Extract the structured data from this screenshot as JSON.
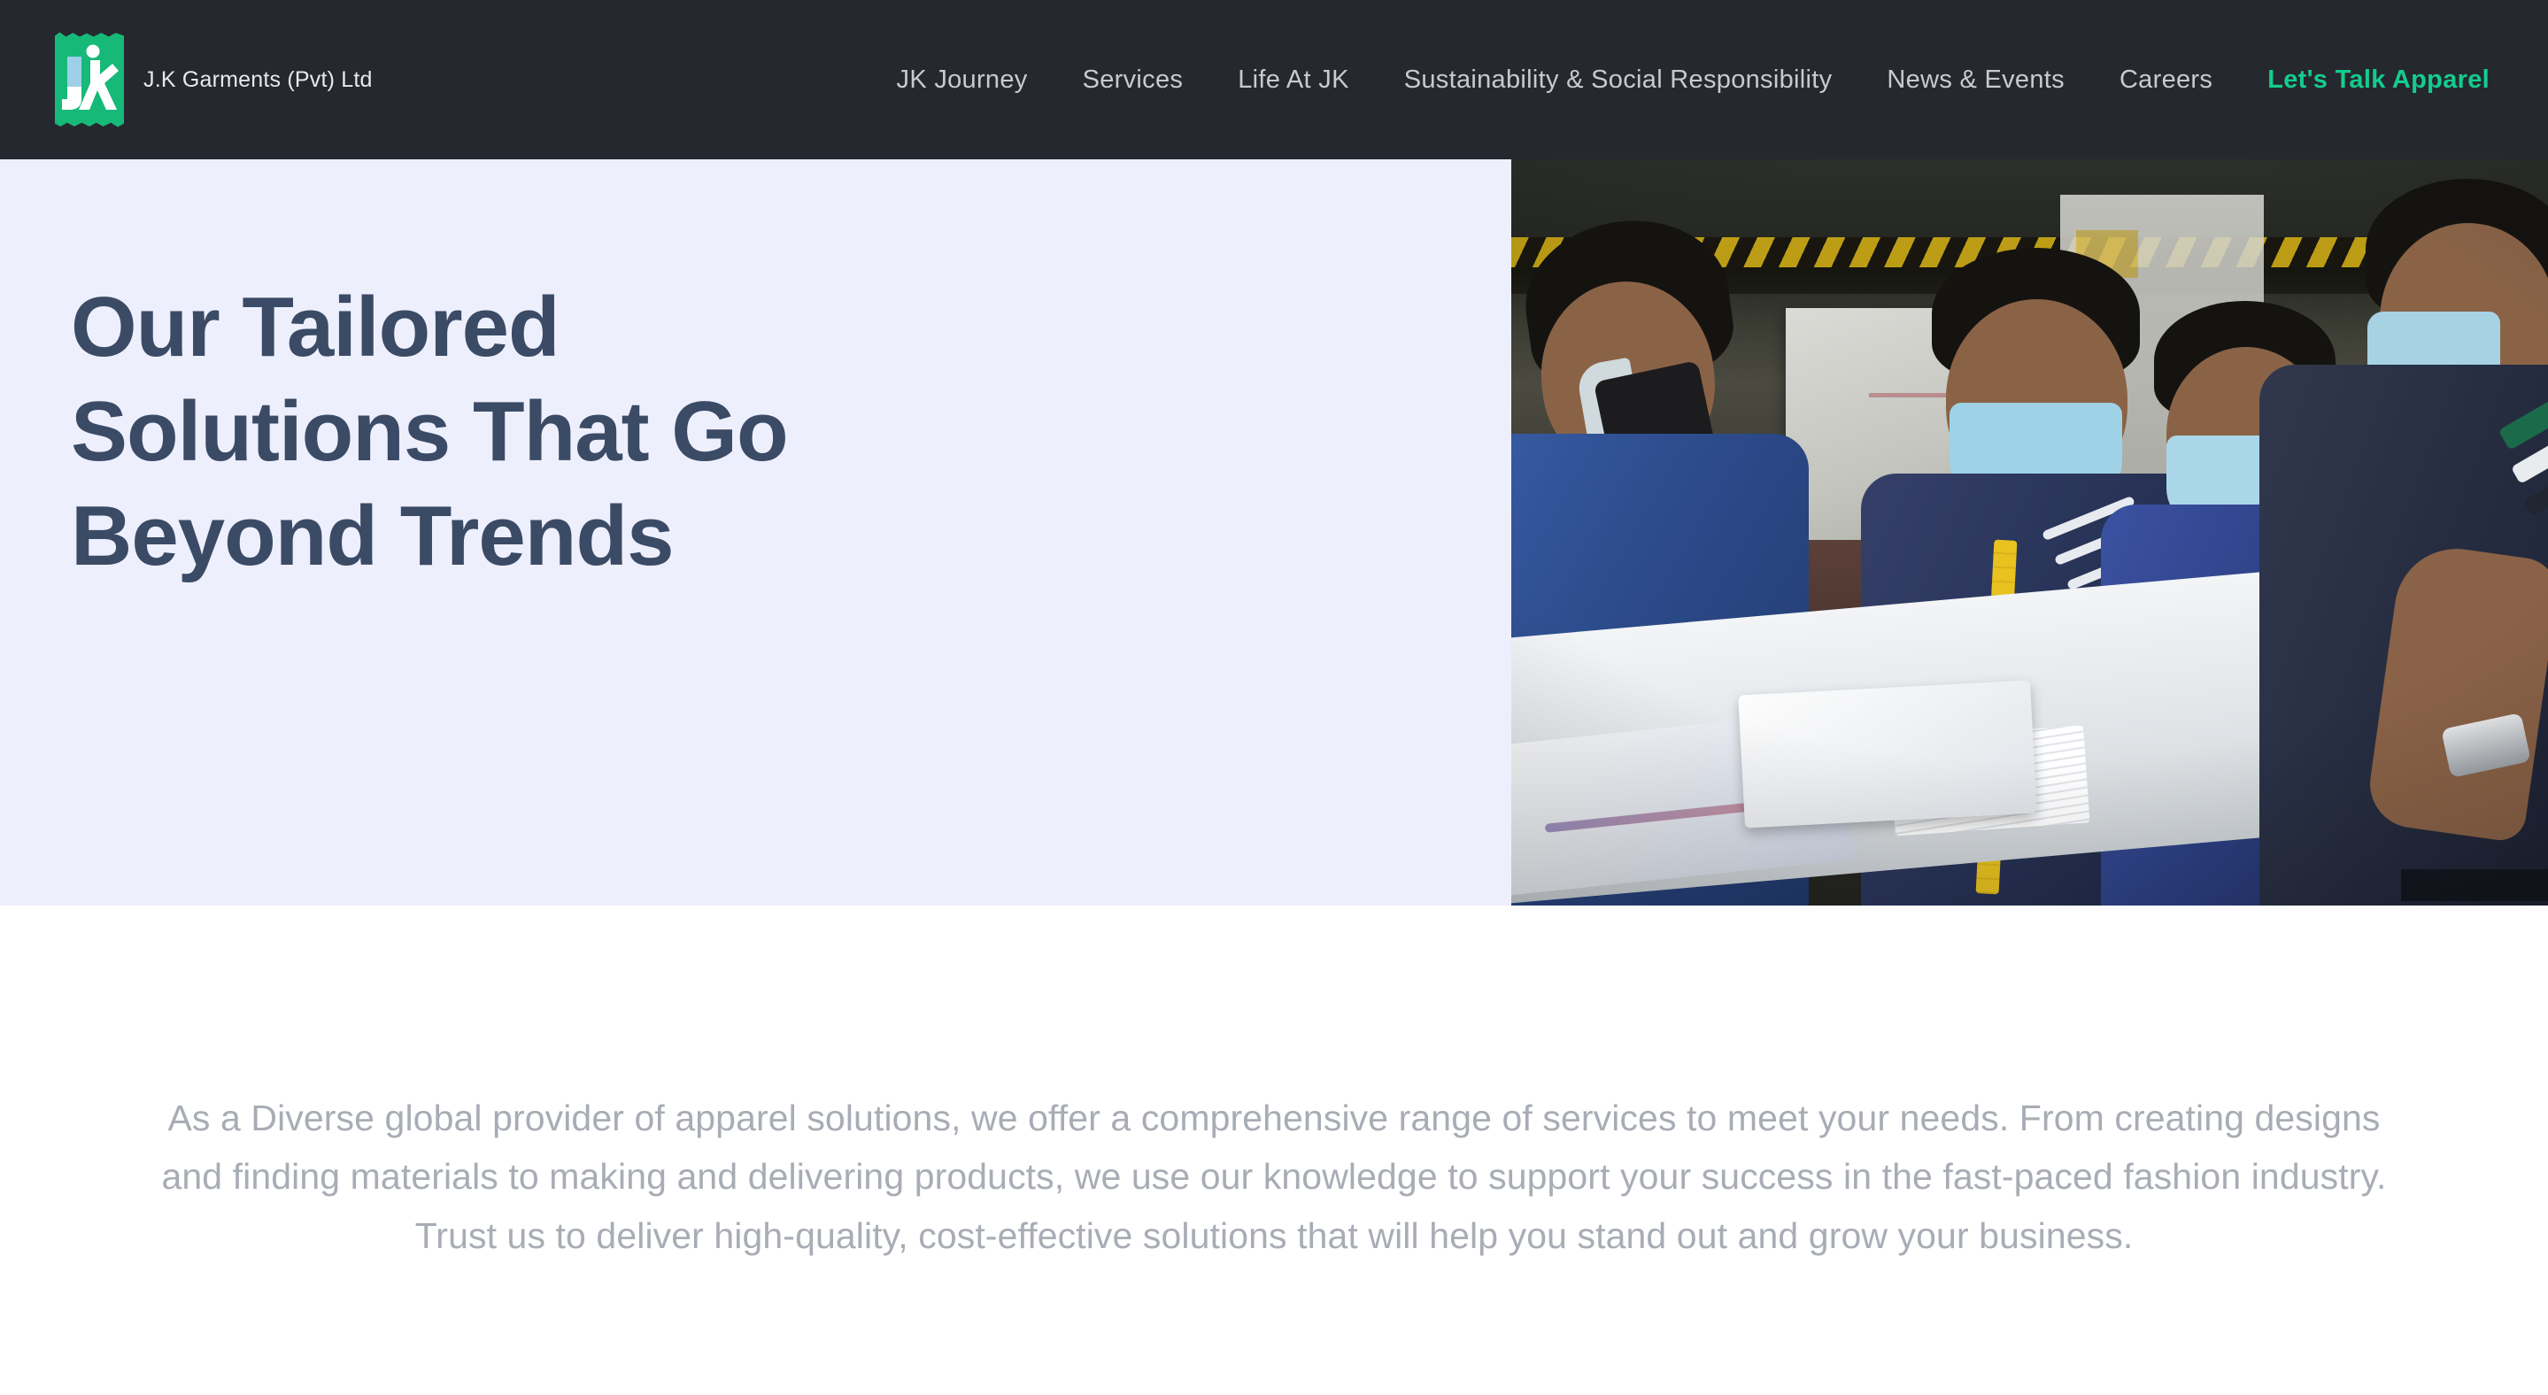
{
  "header": {
    "brand": {
      "logo_icon": "jk-garments-logo-icon",
      "name": "J.K Garments (Pvt) Ltd",
      "logo_green": "#17b978",
      "logo_j_color": "#9ecfe8",
      "logo_k_color": "#ffffff"
    },
    "background_color": "#25282e",
    "nav_text_color": "#c7cace",
    "cta_color": "#13cd8c",
    "nav": [
      {
        "label": "JK Journey",
        "highlighted": false
      },
      {
        "label": "Services",
        "highlighted": false
      },
      {
        "label": "Life At JK",
        "highlighted": false
      },
      {
        "label": "Sustainability & Social Responsibility",
        "highlighted": false
      },
      {
        "label": "News & Events",
        "highlighted": false
      },
      {
        "label": "Careers",
        "highlighted": false
      },
      {
        "label": "Let's Talk Apparel",
        "highlighted": true
      }
    ]
  },
  "hero": {
    "background_color": "#eeeffd",
    "title_color": "#3b4b66",
    "title_lines": [
      "Our Tailored",
      "Solutions That Go",
      "Beyond Trends"
    ],
    "image": {
      "alt": "Four garment factory workers wearing face masks and blue polo shirts examining fabric patterns on a cutting table",
      "scene_name": "jk-garments-factory-team-photo"
    }
  },
  "intro": {
    "background_color": "#ffffff",
    "text_color": "#a8acb5",
    "paragraph": "As a Diverse global provider of apparel solutions, we offer a comprehensive range of services to meet your needs. From creating designs and finding materials to making and delivering products, we use our knowledge to support your success in the fast-paced fashion industry. Trust us to deliver high-quality, cost-effective solutions that will help you stand out and grow your business."
  }
}
